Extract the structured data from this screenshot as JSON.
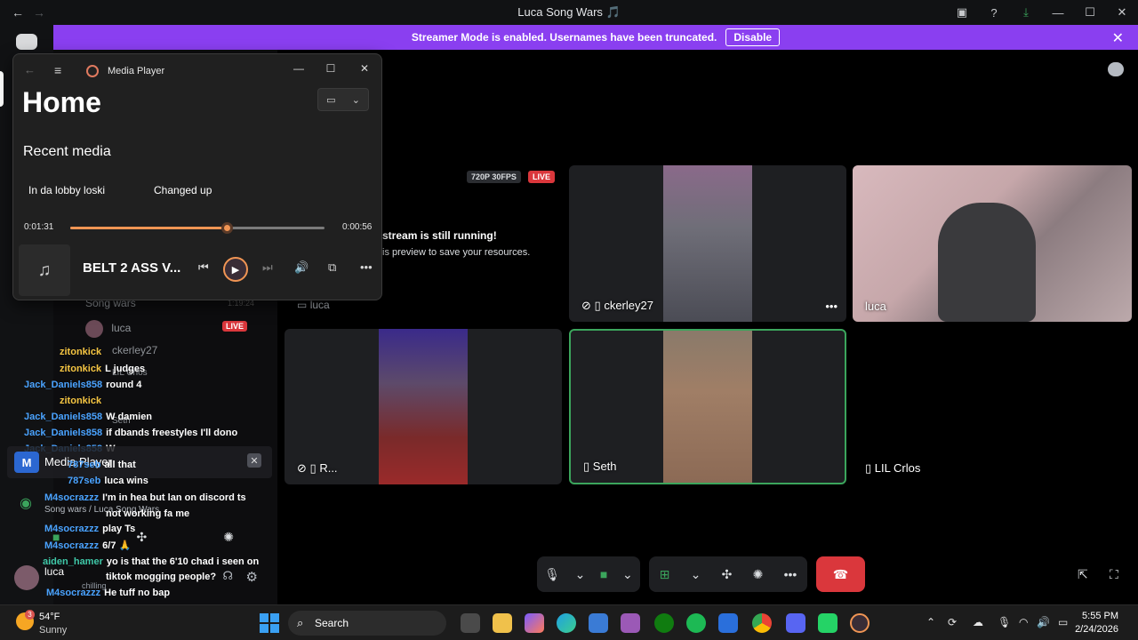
{
  "window": {
    "title": "Luca Song Wars 🎵"
  },
  "banner": {
    "message": "Streamer Mode is enabled. Usernames have been truncated.",
    "button": "Disable"
  },
  "media_player": {
    "app_title": "Media Player",
    "heading": "Home",
    "section": "Recent media",
    "recent": [
      "In da lobby loski",
      "Changed up"
    ],
    "elapsed": "0:01:31",
    "remaining": "0:00:56",
    "progress": 0.615,
    "now_playing": "BELT 2 ASS V..."
  },
  "sidebar": {
    "channel": "Song wars",
    "stream_time": "1:19:24",
    "voice_users": [
      "luca",
      "ckerley27",
      "LIL Crlos",
      "Seth"
    ],
    "live_badge": "LIVE",
    "media_widget": "Media Player",
    "rtc_sub": "Song wars / Luca Song Wars",
    "user": {
      "name": "luca",
      "status": "chilling"
    }
  },
  "chat": [
    {
      "user": "zitonkick",
      "msg": "",
      "color": "#f5c542"
    },
    {
      "user": "zitonkick",
      "msg": "L judges",
      "color": "#f5c542"
    },
    {
      "user": "Jack_Daniels858",
      "msg": "round 4",
      "color": "#4aa3ff"
    },
    {
      "user": "zitonkick",
      "msg": "",
      "color": "#f5c542"
    },
    {
      "user": "Jack_Daniels858",
      "msg": "W damien",
      "color": "#4aa3ff"
    },
    {
      "user": "Jack_Daniels858",
      "msg": "if dbands freestyles I'll dono",
      "color": "#4aa3ff"
    },
    {
      "user": "Jack_Daniels858",
      "msg": "W",
      "color": "#4aa3ff"
    },
    {
      "user": "787seb",
      "msg": "all that",
      "color": "#4aa3ff"
    },
    {
      "user": "787seb",
      "msg": "luca wins",
      "color": "#4aa3ff"
    },
    {
      "user": "M4socrazzz",
      "msg": "I'm in hea but lan on discord ts",
      "color": "#4aa3ff"
    },
    {
      "user": "",
      "msg": "not working fa me",
      "color": "#4aa3ff"
    },
    {
      "user": "M4socrazzz",
      "msg": "play Ts",
      "color": "#4aa3ff"
    },
    {
      "user": "M4socrazzz",
      "msg": "6/7 🙏",
      "color": "#4aa3ff"
    },
    {
      "user": "aiden_hamer",
      "msg": "yo is that the 6'10 chad i seen on",
      "color": "#3fc8a8"
    },
    {
      "user": "",
      "msg": "tiktok mogging people?",
      "color": "#3fc8a8"
    },
    {
      "user": "M4socrazzz",
      "msg": "He tuff no bap",
      "color": "#4aa3ff"
    }
  ],
  "stream": {
    "quality": "720P 30FPS",
    "live": "LIVE",
    "notice_title": "stream is still running!",
    "notice_sub": "is preview to save your resources.",
    "owner": "luca"
  },
  "tiles": {
    "t1": "ckerley27",
    "t2": "luca",
    "t3": "R...",
    "t4": "Seth",
    "t5": "LIL Crlos"
  },
  "taskbar": {
    "temp": "54°F",
    "cond": "Sunny",
    "weather_badge": "3",
    "search": "Search",
    "time": "5:55 PM",
    "date": "2/24/2026"
  },
  "colors": {
    "accent": "#8a3ff0",
    "live": "#da373c",
    "speaking": "#3ba55c",
    "player": "#f09554"
  }
}
